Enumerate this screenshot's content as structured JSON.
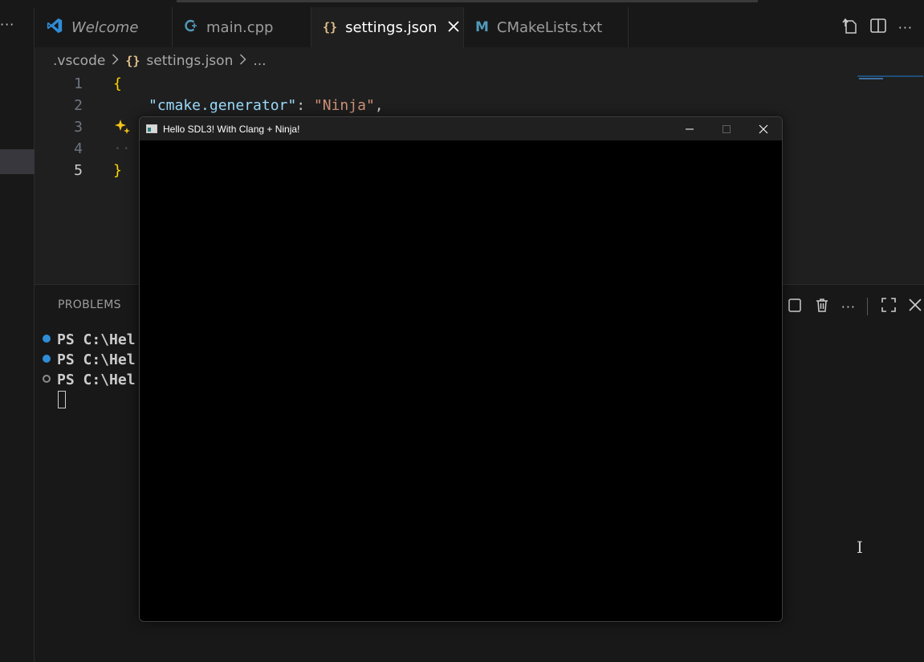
{
  "tabs": [
    {
      "label": "Welcome",
      "icon": "vscode-logo-icon"
    },
    {
      "label": "main.cpp",
      "icon": "cpp-file-icon"
    },
    {
      "label": "settings.json",
      "icon": "json-braces-icon",
      "active": true
    },
    {
      "label": "CMakeLists.txt",
      "icon": "cmake-m-icon"
    }
  ],
  "tab_icons": {
    "json": "{}",
    "cmake": "M"
  },
  "breadcrumb": {
    "folder": ".vscode",
    "file": "settings.json",
    "more": "..."
  },
  "editor": {
    "line_numbers": [
      "1",
      "2",
      "3",
      "4",
      "5"
    ],
    "line1_open": "{",
    "line2_key": "\"cmake.generator\"",
    "line2_colon": ": ",
    "line2_value": "\"Ninja\"",
    "line2_comma": ",",
    "line5_close": "}"
  },
  "panel": {
    "tab_label": "PROBLEMS",
    "terminal_lines": [
      "PS C:\\Hel",
      "PS C:\\Hel",
      "PS C:\\Hel"
    ]
  },
  "sdl_window": {
    "title": "Hello SDL3! With Clang + Ninja!"
  },
  "colors": {
    "editor_bg": "#1f1f1f",
    "panel_bg": "#181818",
    "json_key": "#9cdcfe",
    "json_string": "#ce9178",
    "bracket": "#ffd700",
    "terminal_dot": "#2f8dd7"
  }
}
